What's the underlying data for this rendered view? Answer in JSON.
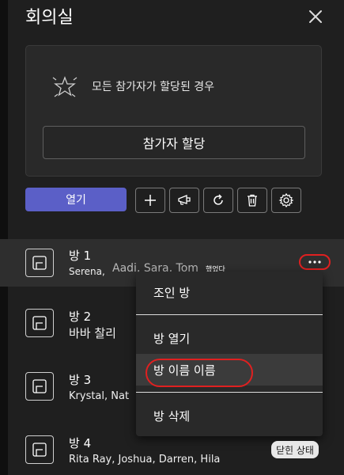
{
  "panel": {
    "title": "회의실",
    "close_icon": "close-icon"
  },
  "assign_card": {
    "message": "모든 참가자가 할당된 경우",
    "assign_label": "참가자 할당"
  },
  "toolbar": {
    "open_label": "열기",
    "tools": [
      "add-icon",
      "announce-icon",
      "recreate-icon",
      "delete-icon",
      "settings-icon"
    ]
  },
  "rooms": [
    {
      "name": "방 1",
      "people": "Serena,",
      "extra_people": "Aadi, Sara, Tom",
      "status": "했었다"
    },
    {
      "name": "방 2",
      "people": "바바 찰리"
    },
    {
      "name": "방 3",
      "people": "Krystal, Nat"
    },
    {
      "name": "방 4",
      "people": "Rita Ray, Joshua, Darren, Hila"
    }
  ],
  "context_menu": {
    "items": [
      "조인 방",
      "방 열기",
      "방 이름 이름",
      "방 삭제"
    ]
  },
  "badge": "닫힌 상태",
  "colors": {
    "accent": "#5b5fc7",
    "highlight_ring": "#e02020",
    "background": "#1f1f1f"
  }
}
